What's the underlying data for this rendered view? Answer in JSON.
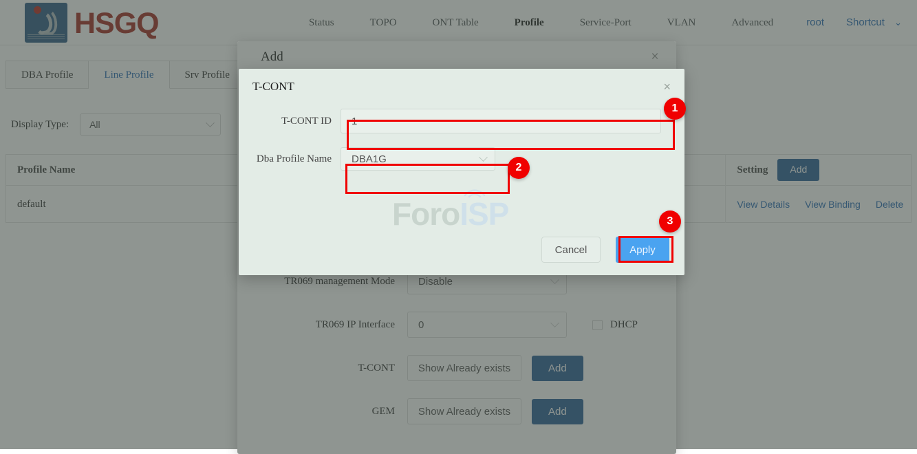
{
  "header": {
    "brand": "HSGQ",
    "nav_items": [
      {
        "label": "Status",
        "active": false
      },
      {
        "label": "TOPO",
        "active": false
      },
      {
        "label": "ONT Table",
        "active": false
      },
      {
        "label": "Profile",
        "active": true
      },
      {
        "label": "Service-Port",
        "active": false
      },
      {
        "label": "VLAN",
        "active": false
      },
      {
        "label": "Advanced",
        "active": false
      }
    ],
    "user": "root",
    "shortcut": "Shortcut",
    "shortcut_caret": "⌄"
  },
  "tabs": [
    {
      "label": "DBA Profile",
      "active": false
    },
    {
      "label": "Line Profile",
      "active": true
    },
    {
      "label": "Srv Profile",
      "active": false
    }
  ],
  "filter": {
    "label": "Display Type:",
    "value": "All"
  },
  "table": {
    "columns": [
      "Profile Name",
      "Setting"
    ],
    "add_button": "Add",
    "rows": [
      {
        "profile_name": "default",
        "actions": [
          "View Details",
          "View Binding",
          "Delete"
        ]
      }
    ]
  },
  "add_dialog": {
    "title": "Add",
    "close": "×",
    "fields": [
      {
        "label": "TR069 management Mode",
        "value": "Disable",
        "type": "select"
      },
      {
        "label": "TR069 IP Interface",
        "value": "0",
        "type": "select",
        "checkbox_label": "DHCP",
        "checkbox_checked": false
      },
      {
        "label": "T-CONT",
        "value": "Show Already exists",
        "type": "ghost",
        "button": "Add"
      },
      {
        "label": "GEM",
        "value": "Show Already exists",
        "type": "ghost",
        "button": "Add"
      }
    ]
  },
  "tcont_dialog": {
    "title": "T-CONT",
    "close": "×",
    "tcont_id_label": "T-CONT ID",
    "tcont_id_value": "1",
    "dba_label": "Dba Profile Name",
    "dba_value": "DBA1G",
    "cancel_label": "Cancel",
    "apply_label": "Apply"
  },
  "annotations": {
    "badges": [
      "1",
      "2",
      "3"
    ],
    "highlight_color": "#f00000"
  },
  "watermark": {
    "part1": "Foro",
    "part2": "ISP"
  }
}
